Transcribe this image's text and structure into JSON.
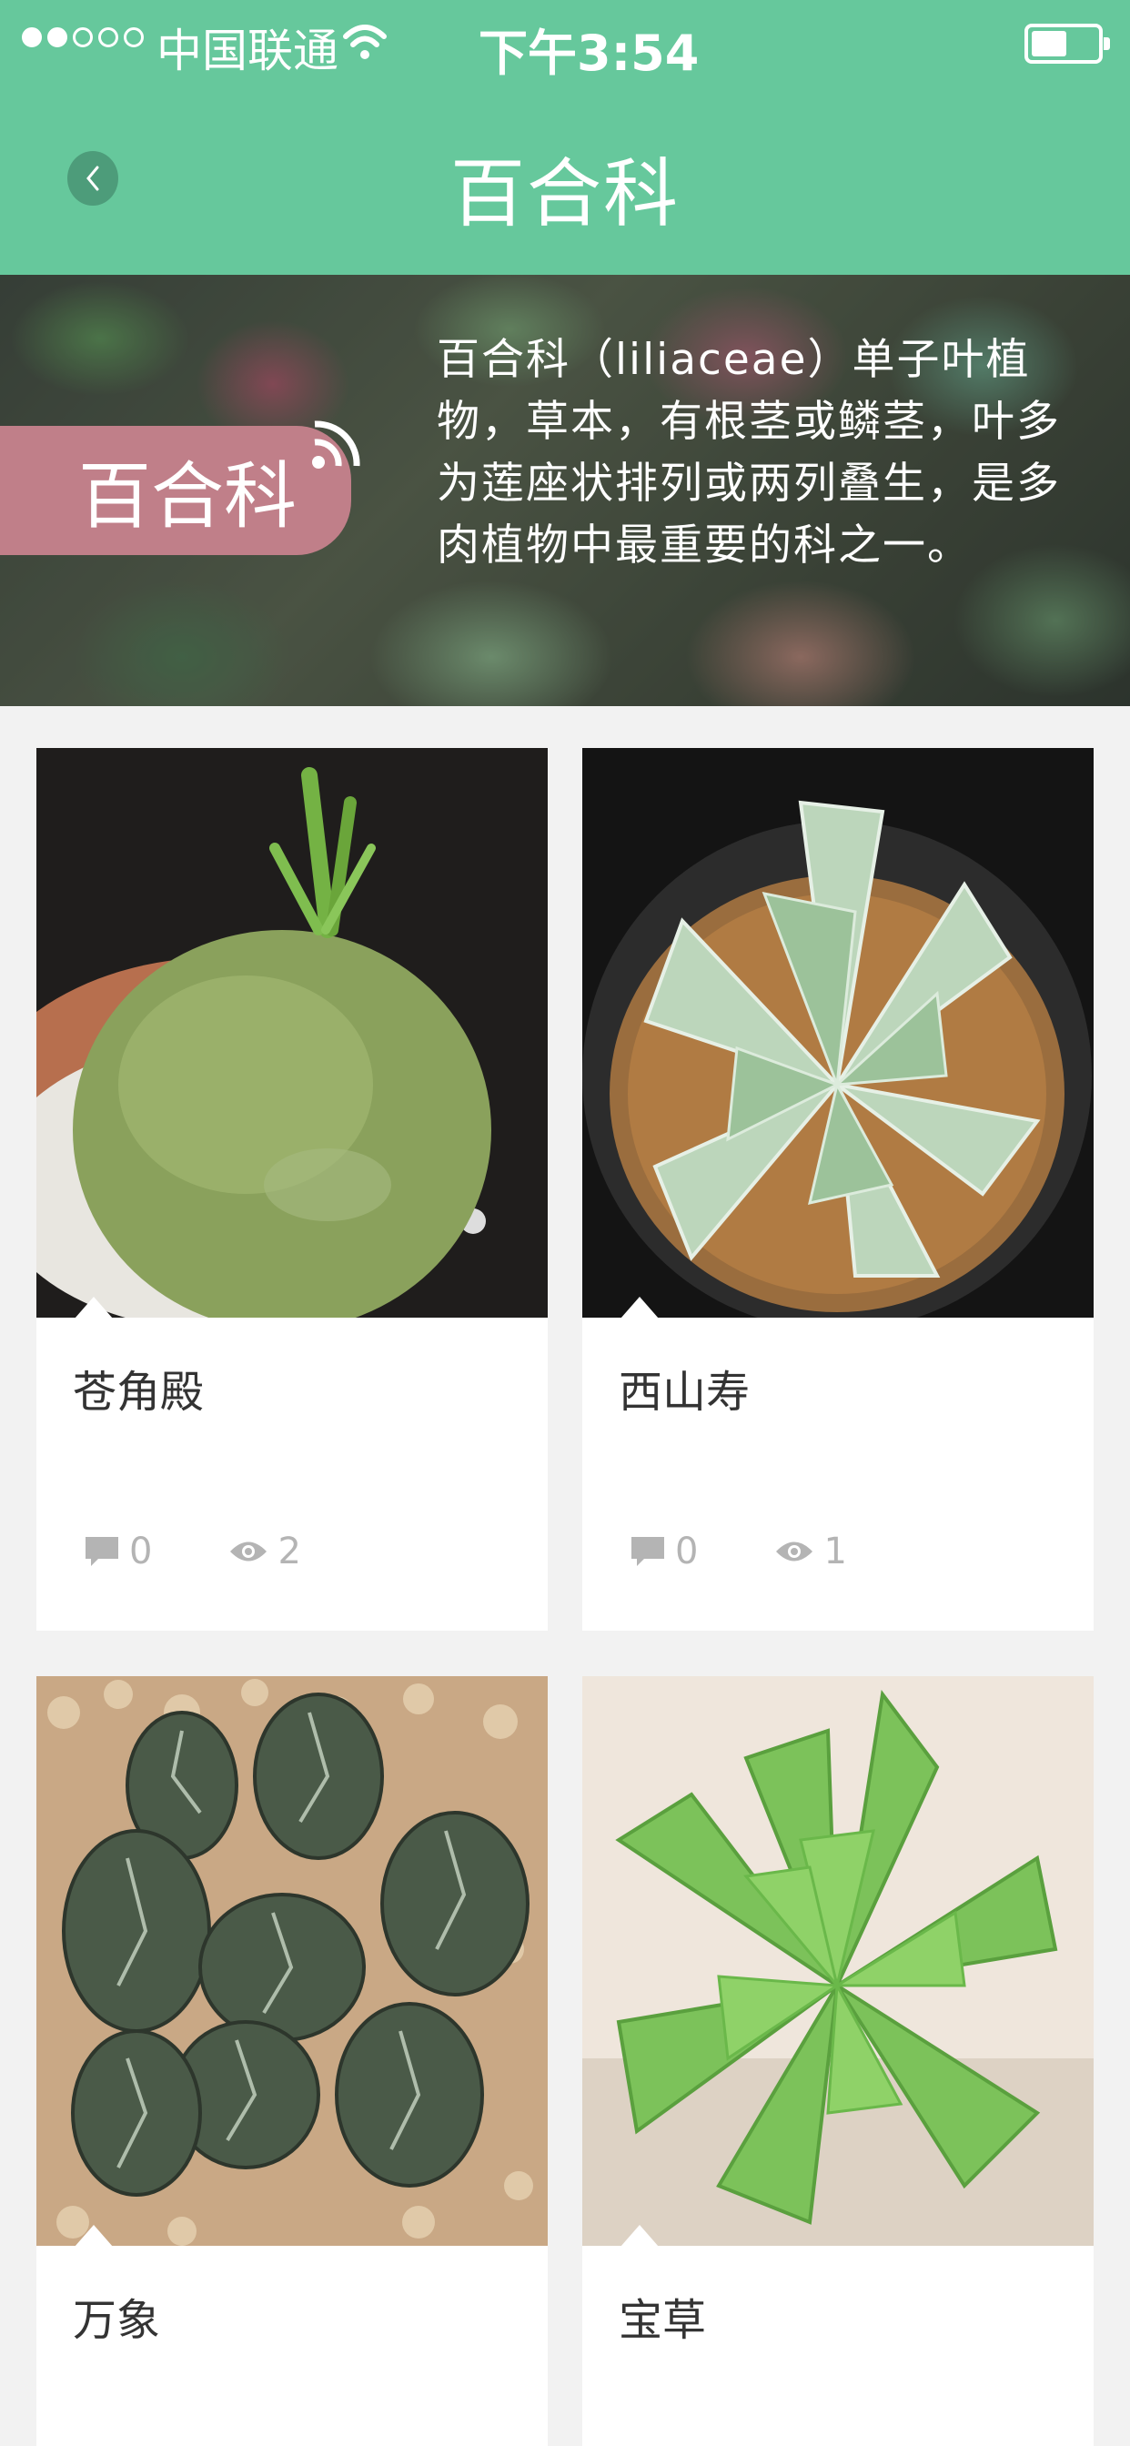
{
  "status_bar": {
    "carrier": "中国联通",
    "time": "下午3:54",
    "signal_filled": 2,
    "signal_total": 5,
    "battery_level": 0.45
  },
  "nav": {
    "title": "百合科",
    "back_icon": "chevron-left-icon"
  },
  "banner": {
    "label": "百合科",
    "description": "百合科（liliaceae）单子叶植物，草本，有根茎或鳞茎，叶多为莲座状排列或两列叠生，是多肉植物中最重要的科之一。"
  },
  "plants": [
    {
      "name": "苍角殿",
      "comments": "0",
      "views": "2"
    },
    {
      "name": "西山寿",
      "comments": "0",
      "views": "1"
    },
    {
      "name": "万象",
      "comments": "",
      "views": ""
    },
    {
      "name": "宝草",
      "comments": "",
      "views": ""
    }
  ],
  "icons": {
    "comment": "comment-icon",
    "views": "eye-icon"
  },
  "colors": {
    "accent": "#66c89c",
    "banner_label": "#c07f89",
    "background": "#f2f2f2"
  }
}
